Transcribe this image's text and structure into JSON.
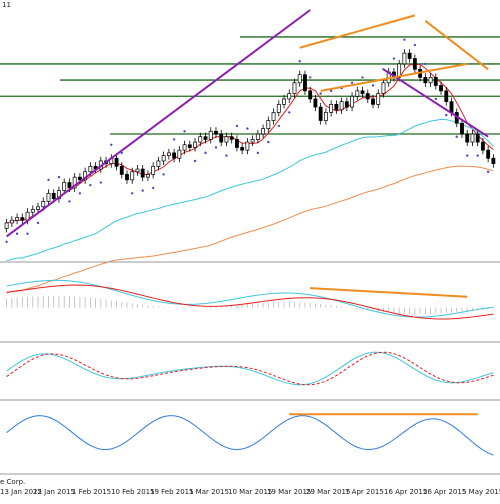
{
  "window": {
    "title_fragment": "11",
    "copyright_fragment": "e Corp."
  },
  "colors": {
    "background": "#ffffff",
    "bull_candle": "#ffffff",
    "bear_candle": "#000000",
    "support_line": "#1f6b1f",
    "channel_line": "#8b1fb5",
    "trend_line": "#f08c1e",
    "sar_dot": "#4b4bc8",
    "ma_fast": "#e81c1c",
    "ma_mid": "#3cc6e0",
    "ma_slow": "#f08c4a",
    "separator": "#9a9a9a",
    "histogram": "#b8b8b8",
    "osc_blue": "#2c7be5"
  },
  "chart_data": [
    {
      "type": "candlestick",
      "title": "",
      "x_tick_labels": [
        "13 Jan 2015",
        "22 Jan 2015",
        "1 Feb 2015",
        "10 Feb 2015",
        "19 Feb 2015",
        "1 Mar 2015",
        "10 Mar 2015",
        "19 Mar 2015",
        "29 Mar 2015",
        "7 Apr 2015",
        "16 Apr 2015",
        "26 Apr 2015",
        "5 May 2015"
      ],
      "candles": [
        {
          "o": 1,
          "c": 3
        },
        {
          "o": 3,
          "c": 4
        },
        {
          "o": 4,
          "c": 5
        },
        {
          "o": 5,
          "c": 4
        },
        {
          "o": 4,
          "c": 7
        },
        {
          "o": 7,
          "c": 8
        },
        {
          "o": 8,
          "c": 9
        },
        {
          "o": 9,
          "c": 11
        },
        {
          "o": 11,
          "c": 14
        },
        {
          "o": 14,
          "c": 12
        },
        {
          "o": 12,
          "c": 15
        },
        {
          "o": 15,
          "c": 18
        },
        {
          "o": 18,
          "c": 16
        },
        {
          "o": 16,
          "c": 20
        },
        {
          "o": 20,
          "c": 19
        },
        {
          "o": 19,
          "c": 22
        },
        {
          "o": 22,
          "c": 24
        },
        {
          "o": 24,
          "c": 23
        },
        {
          "o": 23,
          "c": 26
        },
        {
          "o": 26,
          "c": 25
        },
        {
          "o": 25,
          "c": 27
        },
        {
          "o": 27,
          "c": 24
        },
        {
          "o": 24,
          "c": 21
        },
        {
          "o": 21,
          "c": 19
        },
        {
          "o": 19,
          "c": 22
        },
        {
          "o": 22,
          "c": 23
        },
        {
          "o": 23,
          "c": 20
        },
        {
          "o": 20,
          "c": 21
        },
        {
          "o": 21,
          "c": 24
        },
        {
          "o": 24,
          "c": 26
        },
        {
          "o": 26,
          "c": 28
        },
        {
          "o": 28,
          "c": 29
        },
        {
          "o": 29,
          "c": 27
        },
        {
          "o": 27,
          "c": 30
        },
        {
          "o": 30,
          "c": 32
        },
        {
          "o": 32,
          "c": 31
        },
        {
          "o": 31,
          "c": 33
        },
        {
          "o": 33,
          "c": 35
        },
        {
          "o": 35,
          "c": 34
        },
        {
          "o": 34,
          "c": 37
        },
        {
          "o": 37,
          "c": 36
        },
        {
          "o": 36,
          "c": 33
        },
        {
          "o": 33,
          "c": 35
        },
        {
          "o": 35,
          "c": 34
        },
        {
          "o": 34,
          "c": 31
        },
        {
          "o": 31,
          "c": 30
        },
        {
          "o": 30,
          "c": 33
        },
        {
          "o": 33,
          "c": 34
        },
        {
          "o": 34,
          "c": 36
        },
        {
          "o": 36,
          "c": 38
        },
        {
          "o": 38,
          "c": 41
        },
        {
          "o": 41,
          "c": 44
        },
        {
          "o": 44,
          "c": 47
        },
        {
          "o": 47,
          "c": 49
        },
        {
          "o": 49,
          "c": 51
        },
        {
          "o": 51,
          "c": 55
        },
        {
          "o": 55,
          "c": 58
        },
        {
          "o": 58,
          "c": 52
        },
        {
          "o": 52,
          "c": 49
        },
        {
          "o": 49,
          "c": 46
        },
        {
          "o": 46,
          "c": 41
        },
        {
          "o": 41,
          "c": 44
        },
        {
          "o": 44,
          "c": 47
        },
        {
          "o": 47,
          "c": 45
        },
        {
          "o": 45,
          "c": 48
        },
        {
          "o": 48,
          "c": 46
        },
        {
          "o": 46,
          "c": 50
        },
        {
          "o": 50,
          "c": 52
        },
        {
          "o": 52,
          "c": 51
        },
        {
          "o": 51,
          "c": 49
        },
        {
          "o": 49,
          "c": 47
        },
        {
          "o": 47,
          "c": 51
        },
        {
          "o": 51,
          "c": 55
        },
        {
          "o": 55,
          "c": 59
        },
        {
          "o": 59,
          "c": 57
        },
        {
          "o": 57,
          "c": 62
        },
        {
          "o": 62,
          "c": 66
        },
        {
          "o": 66,
          "c": 64
        },
        {
          "o": 64,
          "c": 60
        },
        {
          "o": 60,
          "c": 57
        },
        {
          "o": 57,
          "c": 55
        },
        {
          "o": 55,
          "c": 57
        },
        {
          "o": 57,
          "c": 54
        },
        {
          "o": 54,
          "c": 52
        },
        {
          "o": 52,
          "c": 48
        },
        {
          "o": 48,
          "c": 44
        },
        {
          "o": 44,
          "c": 40
        },
        {
          "o": 40,
          "c": 36
        },
        {
          "o": 36,
          "c": 33
        },
        {
          "o": 33,
          "c": 36
        },
        {
          "o": 36,
          "c": 33
        },
        {
          "o": 33,
          "c": 30
        },
        {
          "o": 30,
          "c": 27
        },
        {
          "o": 27,
          "c": 25
        }
      ],
      "horizontal_levels": [
        36,
        50,
        56,
        62,
        72
      ],
      "series_labels": []
    },
    {
      "type": "line",
      "panel": "oscillator-1",
      "title": ""
    },
    {
      "type": "line",
      "panel": "oscillator-2",
      "title": ""
    },
    {
      "type": "line",
      "panel": "oscillator-3",
      "title": ""
    }
  ]
}
